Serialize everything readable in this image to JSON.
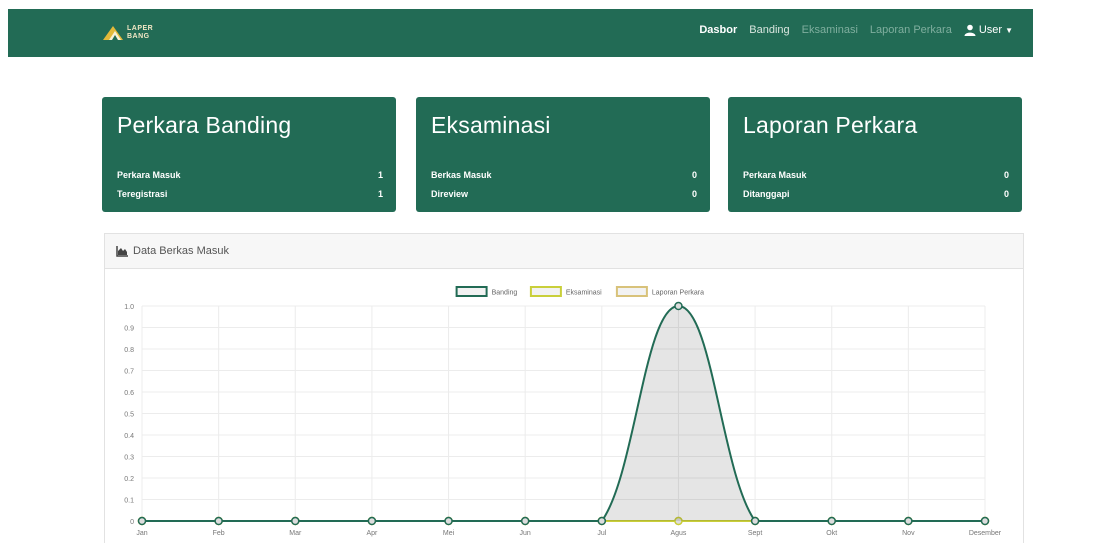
{
  "brand": {
    "logo_text_line1": "LAPER",
    "logo_text_line2": "BANG"
  },
  "nav": {
    "items": [
      {
        "label": "Dasbor",
        "state": "active"
      },
      {
        "label": "Banding",
        "state": "normal"
      },
      {
        "label": "Eksaminasi",
        "state": "muted"
      },
      {
        "label": "Laporan Perkara",
        "state": "muted"
      }
    ],
    "user_label": "User"
  },
  "cards": [
    {
      "title": "Perkara Banding",
      "rows": [
        {
          "label": "Perkara Masuk",
          "value": "1"
        },
        {
          "label": "Teregistrasi",
          "value": "1"
        }
      ]
    },
    {
      "title": "Eksaminasi",
      "rows": [
        {
          "label": "Berkas Masuk",
          "value": "0"
        },
        {
          "label": "Direview",
          "value": "0"
        }
      ]
    },
    {
      "title": "Laporan Perkara",
      "rows": [
        {
          "label": "Perkara Masuk",
          "value": "0"
        },
        {
          "label": "Ditanggapi",
          "value": "0"
        }
      ]
    }
  ],
  "panel": {
    "title": "Data Berkas Masuk",
    "icon": "area-chart-icon"
  },
  "colors": {
    "primary": "#226b55",
    "eksaminasi": "#c9cf3a",
    "laporan": "#d8c27a"
  },
  "chart_data": {
    "type": "line",
    "categories": [
      "Jan",
      "Feb",
      "Mar",
      "Apr",
      "Mei",
      "Jun",
      "Jul",
      "Agus",
      "Sept",
      "Okt",
      "Nov",
      "Desember"
    ],
    "ylim": [
      0,
      1.0
    ],
    "yticks": [
      "0",
      "0.1",
      "0.2",
      "0.3",
      "0.4",
      "0.5",
      "0.6",
      "0.7",
      "0.8",
      "0.9",
      "1.0"
    ],
    "grid": true,
    "legend_position": "top",
    "series": [
      {
        "name": "Banding",
        "values": [
          0,
          0,
          0,
          0,
          0,
          0,
          0,
          1,
          0,
          0,
          0,
          0
        ],
        "color": "#226b55"
      },
      {
        "name": "Eksaminasi",
        "values": [
          0,
          0,
          0,
          0,
          0,
          0,
          0,
          0,
          0,
          0,
          0,
          0
        ],
        "color": "#c9cf3a"
      },
      {
        "name": "Laporan Perkara",
        "values": [
          0,
          0,
          0,
          0,
          0,
          0,
          0,
          0,
          0,
          0,
          0,
          0
        ],
        "color": "#d8c27a"
      }
    ]
  }
}
